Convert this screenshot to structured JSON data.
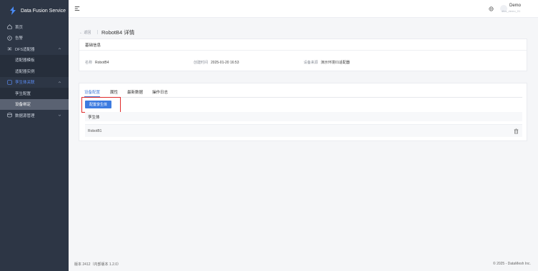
{
  "brand": {
    "name": "Data Fusion Service"
  },
  "sidebar": {
    "items": [
      {
        "label": "首页",
        "icon": "home-icon"
      },
      {
        "label": "告警",
        "icon": "alert-icon"
      },
      {
        "label": "DFS适配器",
        "icon": "shuffle-icon"
      },
      {
        "label": "适配器模板"
      },
      {
        "label": "适配器实例"
      },
      {
        "label": "孪生体关联",
        "icon": "twin-icon"
      },
      {
        "label": "孪生配置"
      },
      {
        "label": "设备绑定"
      },
      {
        "label": "数据源管理",
        "icon": "database-icon"
      }
    ]
  },
  "header": {
    "user_name": "Demo",
    "user_sub": "dfcs_demo_01"
  },
  "page": {
    "back_label": "返回",
    "title": "RobotB4 详情"
  },
  "basic_info": {
    "heading": "基础信息",
    "name_label": "名称",
    "name_value": "RobotB4",
    "created_label": "创建时间",
    "created_value": "2025-01-20 16:53",
    "source_label": "设备来源",
    "source_value": "演示环境01适配器"
  },
  "tabs": [
    "设备配置",
    "属性",
    "最新数据",
    "操作日志"
  ],
  "config": {
    "button_label": "配置孪生体",
    "table_header": "孪生体",
    "rows": [
      "RobotB1"
    ]
  },
  "footer": {
    "version": "版本 2412（内部版本 1.2.0）",
    "copyright": "© 2025 - DataMesh Inc."
  },
  "colors": {
    "accent": "#3d7be0",
    "sidebar_bg": "#2d3645",
    "highlight": "#e02a2a"
  }
}
